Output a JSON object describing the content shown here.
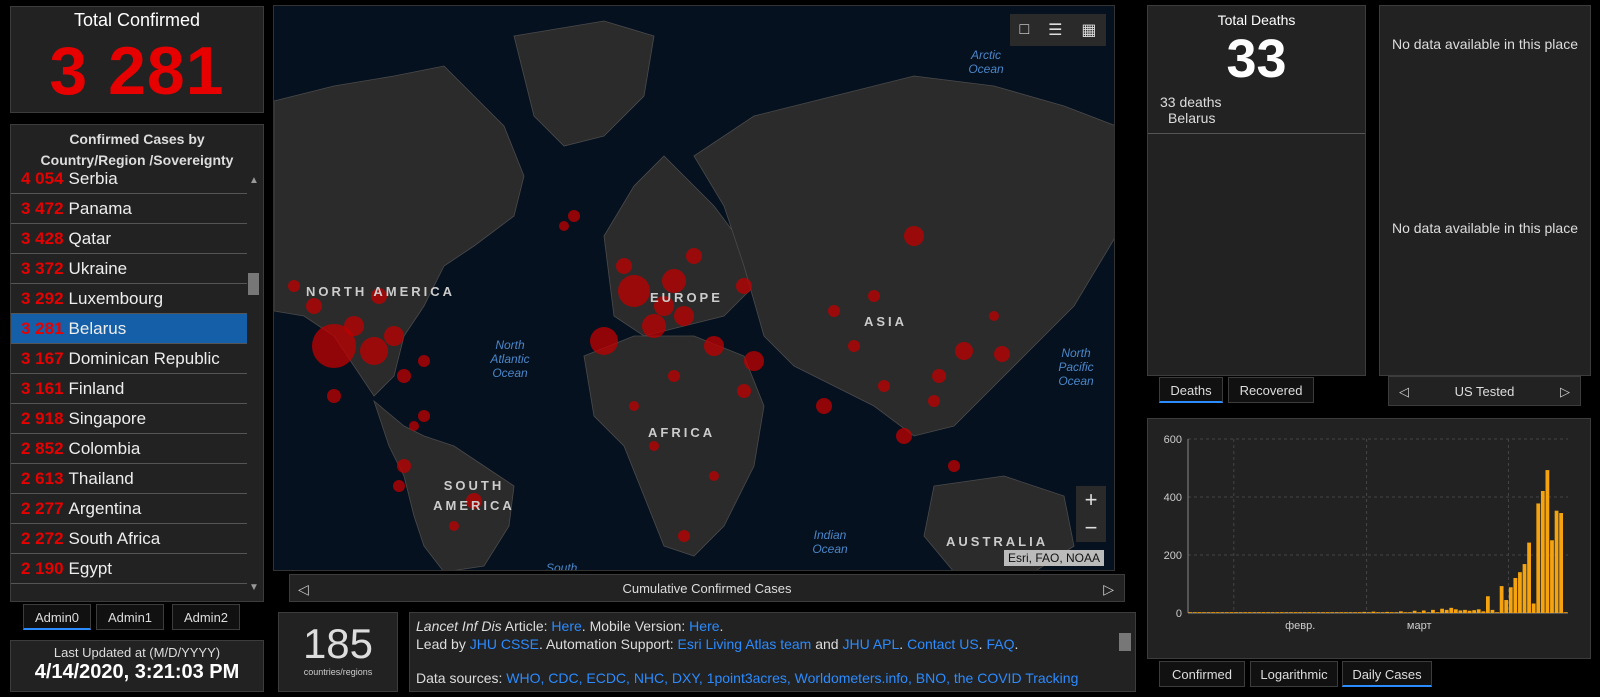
{
  "total": {
    "label": "Total Confirmed",
    "value": "3 281"
  },
  "list": {
    "header": "Confirmed Cases by Country/Region /Sovereignty",
    "rows": [
      {
        "count": "4 054",
        "name": "Serbia"
      },
      {
        "count": "3 472",
        "name": "Panama"
      },
      {
        "count": "3 428",
        "name": "Qatar"
      },
      {
        "count": "3 372",
        "name": "Ukraine"
      },
      {
        "count": "3 292",
        "name": "Luxembourg"
      },
      {
        "count": "3 281",
        "name": "Belarus",
        "selected": true
      },
      {
        "count": "3 167",
        "name": "Dominican Republic"
      },
      {
        "count": "3 161",
        "name": "Finland"
      },
      {
        "count": "2 918",
        "name": "Singapore"
      },
      {
        "count": "2 852",
        "name": "Colombia"
      },
      {
        "count": "2 613",
        "name": "Thailand"
      },
      {
        "count": "2 277",
        "name": "Argentina"
      },
      {
        "count": "2 272",
        "name": "South Africa"
      },
      {
        "count": "2 190",
        "name": "Egypt"
      }
    ]
  },
  "admin_tabs": [
    "Admin0",
    "Admin1",
    "Admin2"
  ],
  "updated": {
    "label": "Last Updated at (M/D/YYYY)",
    "value": "4/14/2020, 3:21:03 PM"
  },
  "map": {
    "regions": [
      "NORTH AMERICA",
      "EUROPE",
      "ASIA",
      "AFRICA",
      "SOUTH AMERICA",
      "AUSTRALIA",
      "South"
    ],
    "oceans": [
      "Arctic Ocean",
      "North Atlantic Ocean",
      "North Pacific Ocean",
      "Indian Ocean"
    ],
    "attribution": "Esri, FAO, NOAA",
    "caption": "Cumulative Confirmed Cases",
    "icons": [
      "bookmark-icon",
      "list-icon",
      "qr-code-icon",
      "zoom-in-icon",
      "zoom-out-icon"
    ]
  },
  "countries": {
    "value": "185",
    "label": "countries/regions"
  },
  "info": {
    "article_label": "Lancet Inf Dis",
    "article_word": "Article:",
    "here": "Here",
    "mobile": "Mobile Version:",
    "lead_by": "Lead by",
    "jhu_csse": "JHU CSSE",
    "automation": "Automation Support:",
    "esri_team": "Esri Living Atlas team",
    "and": "and",
    "jhu_apl": "JHU APL",
    "contact": "Contact US",
    "faq": "FAQ",
    "sources_label": "Data sources:",
    "sources": "WHO, CDC, ECDC, NHC, DXY, 1point3acres, Worldometers.info, BNO, the COVID Tracking"
  },
  "deaths": {
    "label": "Total Deaths",
    "value": "33",
    "detail_count": "33",
    "detail_unit": "deaths",
    "detail_place": "Belarus"
  },
  "deaths_tabs": [
    "Deaths",
    "Recovered"
  ],
  "nodata": {
    "msg1": "No data available in this place",
    "msg2": "No data available in this place"
  },
  "us_tested": "US Tested",
  "chart_tabs": [
    "Confirmed",
    "Logarithmic",
    "Daily Cases"
  ],
  "colors": {
    "accent": "#2b8bff",
    "confirmed": "#e60000",
    "bars": "#f5a30f",
    "selected_row": "#155fa8"
  },
  "chart_data": {
    "type": "bar",
    "title": "",
    "xlabel": "",
    "ylabel": "",
    "ylim": [
      0,
      600
    ],
    "yticks": [
      0,
      200,
      400,
      600
    ],
    "x_tick_labels": [
      "февр.",
      "март"
    ],
    "x": [
      "01-22",
      "01-23",
      "01-24",
      "01-25",
      "01-26",
      "01-27",
      "01-28",
      "01-29",
      "01-30",
      "01-31",
      "02-01",
      "02-02",
      "02-03",
      "02-04",
      "02-05",
      "02-06",
      "02-07",
      "02-08",
      "02-09",
      "02-10",
      "02-11",
      "02-12",
      "02-13",
      "02-14",
      "02-15",
      "02-16",
      "02-17",
      "02-18",
      "02-19",
      "02-20",
      "02-21",
      "02-22",
      "02-23",
      "02-24",
      "02-25",
      "02-26",
      "02-27",
      "02-28",
      "02-29",
      "03-01",
      "03-02",
      "03-03",
      "03-04",
      "03-05",
      "03-06",
      "03-07",
      "03-08",
      "03-09",
      "03-10",
      "03-11",
      "03-12",
      "03-13",
      "03-14",
      "03-15",
      "03-16",
      "03-17",
      "03-18",
      "03-19",
      "03-20",
      "03-21",
      "03-22",
      "03-23",
      "03-24",
      "03-25",
      "03-26",
      "03-27",
      "03-28",
      "03-29",
      "03-30",
      "03-31",
      "04-01",
      "04-02",
      "04-03",
      "04-04",
      "04-05",
      "04-06",
      "04-07",
      "04-08",
      "04-09",
      "04-10",
      "04-11",
      "04-12",
      "04-13"
    ],
    "values": [
      0,
      0,
      0,
      0,
      0,
      0,
      0,
      0,
      0,
      0,
      0,
      0,
      0,
      0,
      0,
      0,
      0,
      0,
      0,
      0,
      0,
      0,
      0,
      0,
      0,
      0,
      0,
      0,
      0,
      0,
      0,
      0,
      0,
      0,
      0,
      0,
      0,
      0,
      1,
      0,
      2,
      0,
      0,
      1,
      0,
      0,
      3,
      0,
      0,
      5,
      0,
      6,
      0,
      8,
      0,
      12,
      8,
      15,
      10,
      6,
      8,
      5,
      7,
      10,
      3,
      55,
      8,
      0,
      90,
      42,
      86,
      118,
      138,
      166,
      240,
      30,
      375,
      418,
      490,
      248,
      350,
      342,
      0
    ]
  }
}
